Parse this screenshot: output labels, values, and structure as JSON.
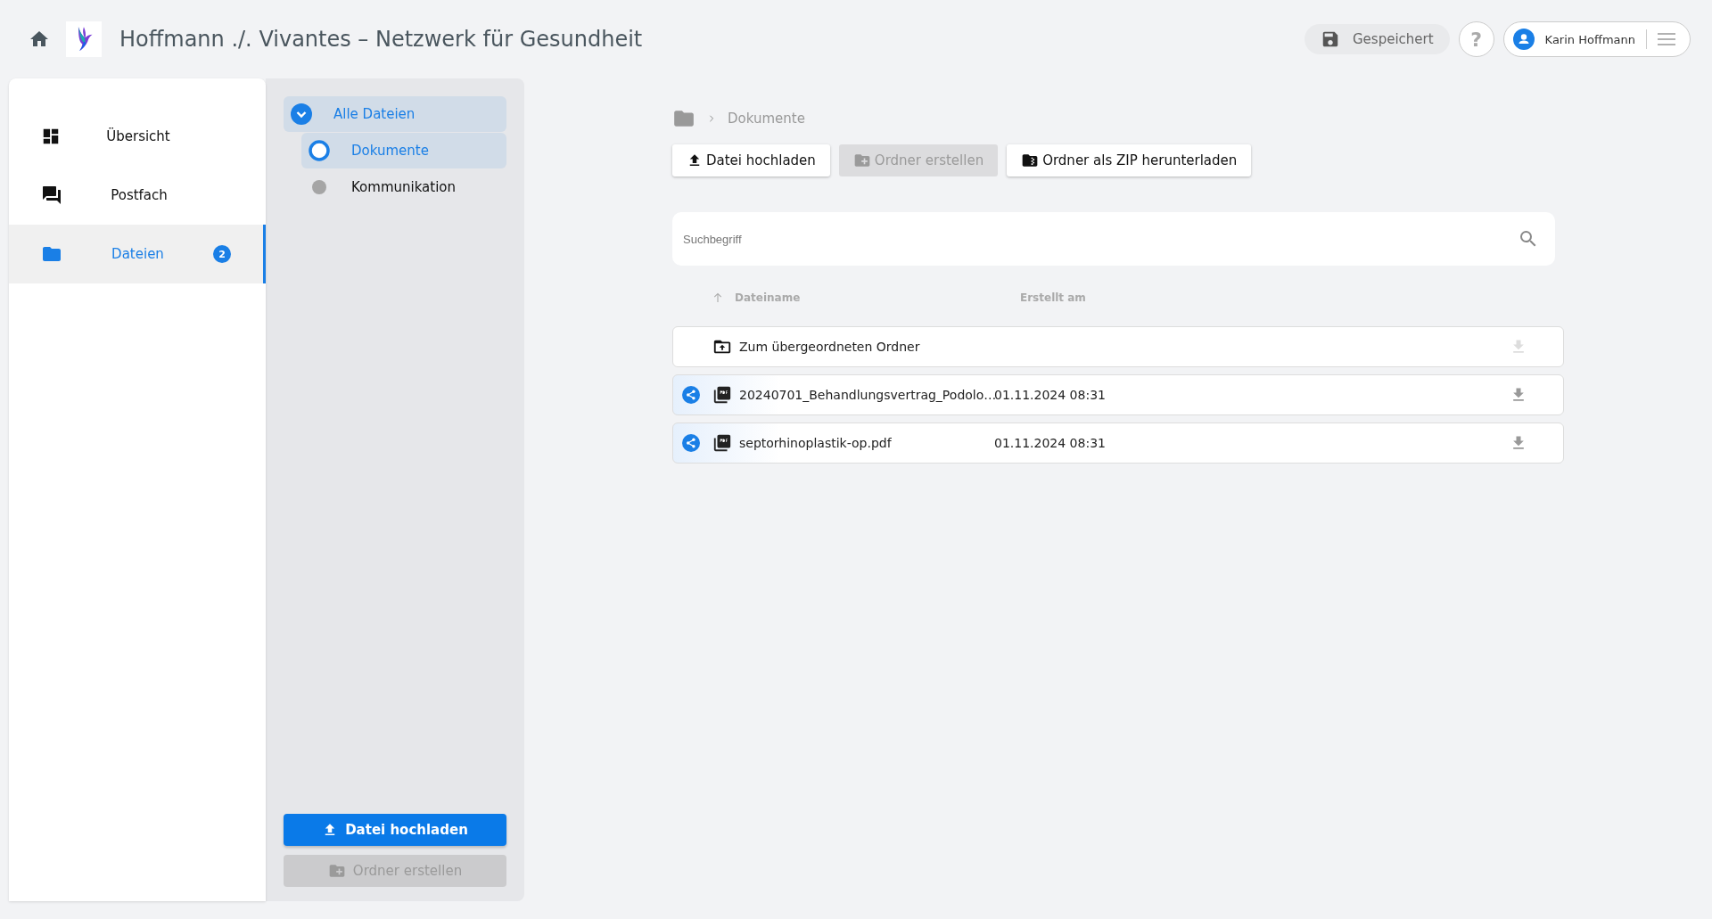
{
  "header": {
    "title": "Hoffmann ./. Vivantes – Netzwerk für Gesundheit",
    "save_status": "Gespeichert",
    "help": "?",
    "user": "Karin Hoffmann"
  },
  "sidebar": {
    "items": [
      {
        "label": "Übersicht",
        "kind": "dashboard",
        "selected": false
      },
      {
        "label": "Postfach",
        "kind": "chat",
        "selected": false
      },
      {
        "label": "Dateien",
        "kind": "folder",
        "selected": true,
        "badge": "2"
      }
    ]
  },
  "folder_tree": {
    "items": [
      {
        "label": "Alle Dateien",
        "selected": true,
        "expanded": true,
        "children": [
          {
            "label": "Dokumente",
            "selected": true
          },
          {
            "label": "Kommunikation",
            "selected": false
          }
        ]
      }
    ],
    "buttons": [
      {
        "label": "Datei hochladen",
        "kind": "upload",
        "disabled": false
      },
      {
        "label": "Ordner erstellen",
        "kind": "new-folder",
        "disabled": true
      }
    ]
  },
  "breadcrumb": {
    "items": [
      "Dokumente"
    ]
  },
  "toolbar": {
    "buttons": [
      {
        "label": "Datei hochladen",
        "kind": "upload",
        "disabled": false
      },
      {
        "label": "Ordner erstellen",
        "kind": "new-folder",
        "disabled": true
      },
      {
        "label": "Ordner als ZIP herunterladen",
        "kind": "zip",
        "disabled": false
      }
    ]
  },
  "search": {
    "placeholder": "Suchbegriff"
  },
  "table": {
    "columns": [
      "Dateiname",
      "Erstellt am"
    ],
    "rows": [
      {
        "kind": "parent",
        "name": "Zum übergeordneten Ordner",
        "shared": false,
        "download_disabled": true
      },
      {
        "kind": "pdf",
        "name": "20240701_Behandlungsvertrag_Podolo…",
        "created": "01.11.2024 08:31",
        "shared": true,
        "download_disabled": false
      },
      {
        "kind": "pdf",
        "name": "septorhinoplastik-op.pdf",
        "created": "01.11.2024 08:31",
        "shared": true,
        "download_disabled": false
      }
    ]
  }
}
